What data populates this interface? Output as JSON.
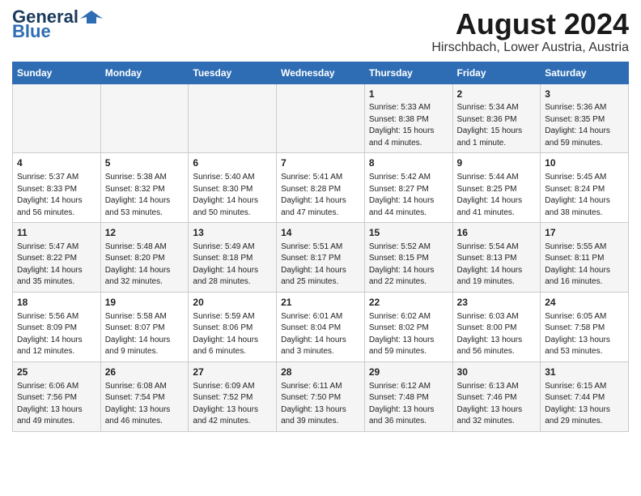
{
  "logo": {
    "line1": "General",
    "line2": "Blue",
    "icon": "▶"
  },
  "title": "August 2024",
  "subtitle": "Hirschbach, Lower Austria, Austria",
  "days": [
    "Sunday",
    "Monday",
    "Tuesday",
    "Wednesday",
    "Thursday",
    "Friday",
    "Saturday"
  ],
  "weeks": [
    {
      "cells": [
        {
          "date": "",
          "content": ""
        },
        {
          "date": "",
          "content": ""
        },
        {
          "date": "",
          "content": ""
        },
        {
          "date": "",
          "content": ""
        },
        {
          "date": "1",
          "content": "Sunrise: 5:33 AM\nSunset: 8:38 PM\nDaylight: 15 hours\nand 4 minutes."
        },
        {
          "date": "2",
          "content": "Sunrise: 5:34 AM\nSunset: 8:36 PM\nDaylight: 15 hours\nand 1 minute."
        },
        {
          "date": "3",
          "content": "Sunrise: 5:36 AM\nSunset: 8:35 PM\nDaylight: 14 hours\nand 59 minutes."
        }
      ]
    },
    {
      "cells": [
        {
          "date": "4",
          "content": "Sunrise: 5:37 AM\nSunset: 8:33 PM\nDaylight: 14 hours\nand 56 minutes."
        },
        {
          "date": "5",
          "content": "Sunrise: 5:38 AM\nSunset: 8:32 PM\nDaylight: 14 hours\nand 53 minutes."
        },
        {
          "date": "6",
          "content": "Sunrise: 5:40 AM\nSunset: 8:30 PM\nDaylight: 14 hours\nand 50 minutes."
        },
        {
          "date": "7",
          "content": "Sunrise: 5:41 AM\nSunset: 8:28 PM\nDaylight: 14 hours\nand 47 minutes."
        },
        {
          "date": "8",
          "content": "Sunrise: 5:42 AM\nSunset: 8:27 PM\nDaylight: 14 hours\nand 44 minutes."
        },
        {
          "date": "9",
          "content": "Sunrise: 5:44 AM\nSunset: 8:25 PM\nDaylight: 14 hours\nand 41 minutes."
        },
        {
          "date": "10",
          "content": "Sunrise: 5:45 AM\nSunset: 8:24 PM\nDaylight: 14 hours\nand 38 minutes."
        }
      ]
    },
    {
      "cells": [
        {
          "date": "11",
          "content": "Sunrise: 5:47 AM\nSunset: 8:22 PM\nDaylight: 14 hours\nand 35 minutes."
        },
        {
          "date": "12",
          "content": "Sunrise: 5:48 AM\nSunset: 8:20 PM\nDaylight: 14 hours\nand 32 minutes."
        },
        {
          "date": "13",
          "content": "Sunrise: 5:49 AM\nSunset: 8:18 PM\nDaylight: 14 hours\nand 28 minutes."
        },
        {
          "date": "14",
          "content": "Sunrise: 5:51 AM\nSunset: 8:17 PM\nDaylight: 14 hours\nand 25 minutes."
        },
        {
          "date": "15",
          "content": "Sunrise: 5:52 AM\nSunset: 8:15 PM\nDaylight: 14 hours\nand 22 minutes."
        },
        {
          "date": "16",
          "content": "Sunrise: 5:54 AM\nSunset: 8:13 PM\nDaylight: 14 hours\nand 19 minutes."
        },
        {
          "date": "17",
          "content": "Sunrise: 5:55 AM\nSunset: 8:11 PM\nDaylight: 14 hours\nand 16 minutes."
        }
      ]
    },
    {
      "cells": [
        {
          "date": "18",
          "content": "Sunrise: 5:56 AM\nSunset: 8:09 PM\nDaylight: 14 hours\nand 12 minutes."
        },
        {
          "date": "19",
          "content": "Sunrise: 5:58 AM\nSunset: 8:07 PM\nDaylight: 14 hours\nand 9 minutes."
        },
        {
          "date": "20",
          "content": "Sunrise: 5:59 AM\nSunset: 8:06 PM\nDaylight: 14 hours\nand 6 minutes."
        },
        {
          "date": "21",
          "content": "Sunrise: 6:01 AM\nSunset: 8:04 PM\nDaylight: 14 hours\nand 3 minutes."
        },
        {
          "date": "22",
          "content": "Sunrise: 6:02 AM\nSunset: 8:02 PM\nDaylight: 13 hours\nand 59 minutes."
        },
        {
          "date": "23",
          "content": "Sunrise: 6:03 AM\nSunset: 8:00 PM\nDaylight: 13 hours\nand 56 minutes."
        },
        {
          "date": "24",
          "content": "Sunrise: 6:05 AM\nSunset: 7:58 PM\nDaylight: 13 hours\nand 53 minutes."
        }
      ]
    },
    {
      "cells": [
        {
          "date": "25",
          "content": "Sunrise: 6:06 AM\nSunset: 7:56 PM\nDaylight: 13 hours\nand 49 minutes."
        },
        {
          "date": "26",
          "content": "Sunrise: 6:08 AM\nSunset: 7:54 PM\nDaylight: 13 hours\nand 46 minutes."
        },
        {
          "date": "27",
          "content": "Sunrise: 6:09 AM\nSunset: 7:52 PM\nDaylight: 13 hours\nand 42 minutes."
        },
        {
          "date": "28",
          "content": "Sunrise: 6:11 AM\nSunset: 7:50 PM\nDaylight: 13 hours\nand 39 minutes."
        },
        {
          "date": "29",
          "content": "Sunrise: 6:12 AM\nSunset: 7:48 PM\nDaylight: 13 hours\nand 36 minutes."
        },
        {
          "date": "30",
          "content": "Sunrise: 6:13 AM\nSunset: 7:46 PM\nDaylight: 13 hours\nand 32 minutes."
        },
        {
          "date": "31",
          "content": "Sunrise: 6:15 AM\nSunset: 7:44 PM\nDaylight: 13 hours\nand 29 minutes."
        }
      ]
    }
  ]
}
